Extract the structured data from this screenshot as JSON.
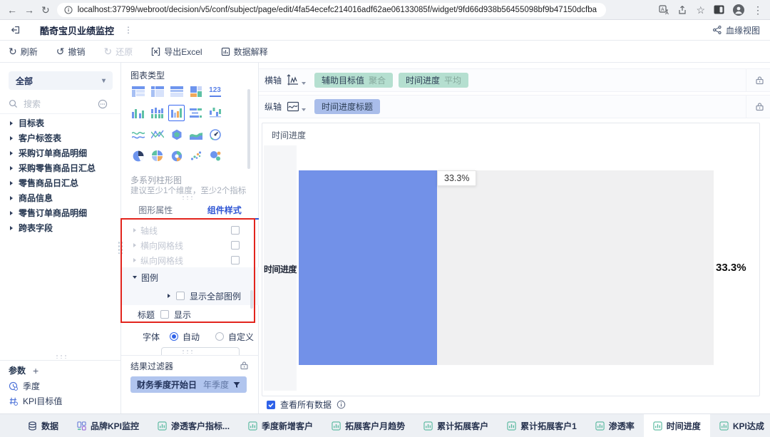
{
  "browser": {
    "url": "localhost:37799/webroot/decision/v5/conf/subject/page/edit/4fa54ecefc214016adf62ae06133085f/widget/9fd66d938b56455098bf9b47150dcfba"
  },
  "app_header": {
    "title": "酷奇宝贝业绩监控",
    "lineage": "血缘视图"
  },
  "toolbar": {
    "refresh": "刷新",
    "undo": "撤销",
    "redo": "还原",
    "export_excel": "导出Excel",
    "data_explain": "数据解释"
  },
  "sidebar": {
    "all_dropdown": "全部",
    "search_placeholder": "搜索",
    "tables": [
      "目标表",
      "客户标签表",
      "采购订单商品明细",
      "采购零售商品日汇总",
      "零售商品日汇总",
      "商品信息",
      "零售订单商品明细",
      "跨表字段"
    ],
    "params_title": "参数",
    "param_items": [
      "季度",
      "KPI目标值"
    ]
  },
  "chart_config": {
    "chart_type_title": "图表类型",
    "kpi_icon_text": "123",
    "selected_type_name": "多系列柱形图",
    "selected_type_hint": "建议至少1个维度，至少2个指标",
    "tab_graphic": "图形属性",
    "tab_style": "组件样式",
    "style_rows": [
      "轴线",
      "横向网格线",
      "纵向网格线"
    ],
    "legend_title": "图例",
    "legend_show_all": "显示全部图例",
    "title_row_label": "标题",
    "title_row_show": "显示",
    "font_label": "字体",
    "font_auto": "自动",
    "font_custom": "自定义",
    "result_filter_title": "结果过滤器",
    "filter_name": "财务季度开始日",
    "filter_value": "年季度"
  },
  "axis_config": {
    "x_axis_label": "横轴",
    "y_axis_label": "纵轴",
    "x_pill_1_name": "辅助目标值",
    "x_pill_1_agg": "聚合",
    "x_pill_2_name": "时间进度",
    "x_pill_2_agg": "平均",
    "y_pill_1_name": "时间进度标题"
  },
  "chart_data": {
    "type": "bar",
    "orientation": "horizontal",
    "series_label": "时间进度",
    "categories": [
      "时间进度"
    ],
    "values": [
      33.3
    ],
    "unit": "%",
    "xlim": [
      0,
      100
    ],
    "data_label": "33.3%",
    "axis_value_label": "33.3%",
    "grid": false,
    "legend": false
  },
  "chart_area": {
    "series_label": "时间进度",
    "category_label": "时间进度",
    "bar_tooltip": "33.3%",
    "total_value": "33.3%",
    "view_all_label": "查看所有数据"
  },
  "bottom_bar": {
    "tabs": [
      {
        "label": "数据"
      },
      {
        "label": "品牌KPI监控"
      },
      {
        "label": "渗透客户指标..."
      },
      {
        "label": "季度新增客户"
      },
      {
        "label": "拓展客户月趋势"
      },
      {
        "label": "累计拓展客户"
      },
      {
        "label": "累计拓展客户1"
      },
      {
        "label": "渗透率"
      },
      {
        "label": "时间进度",
        "active": true
      },
      {
        "label": "KPI达成"
      }
    ]
  },
  "colors": {
    "accent_blue": "#2e55d4",
    "bar_blue": "#7291e8",
    "pill_green": "#b5dfd0",
    "pill_blue": "#a9bdea",
    "filter_pill_blue": "#b1c5ee",
    "annotation_red": "#e2241d"
  }
}
